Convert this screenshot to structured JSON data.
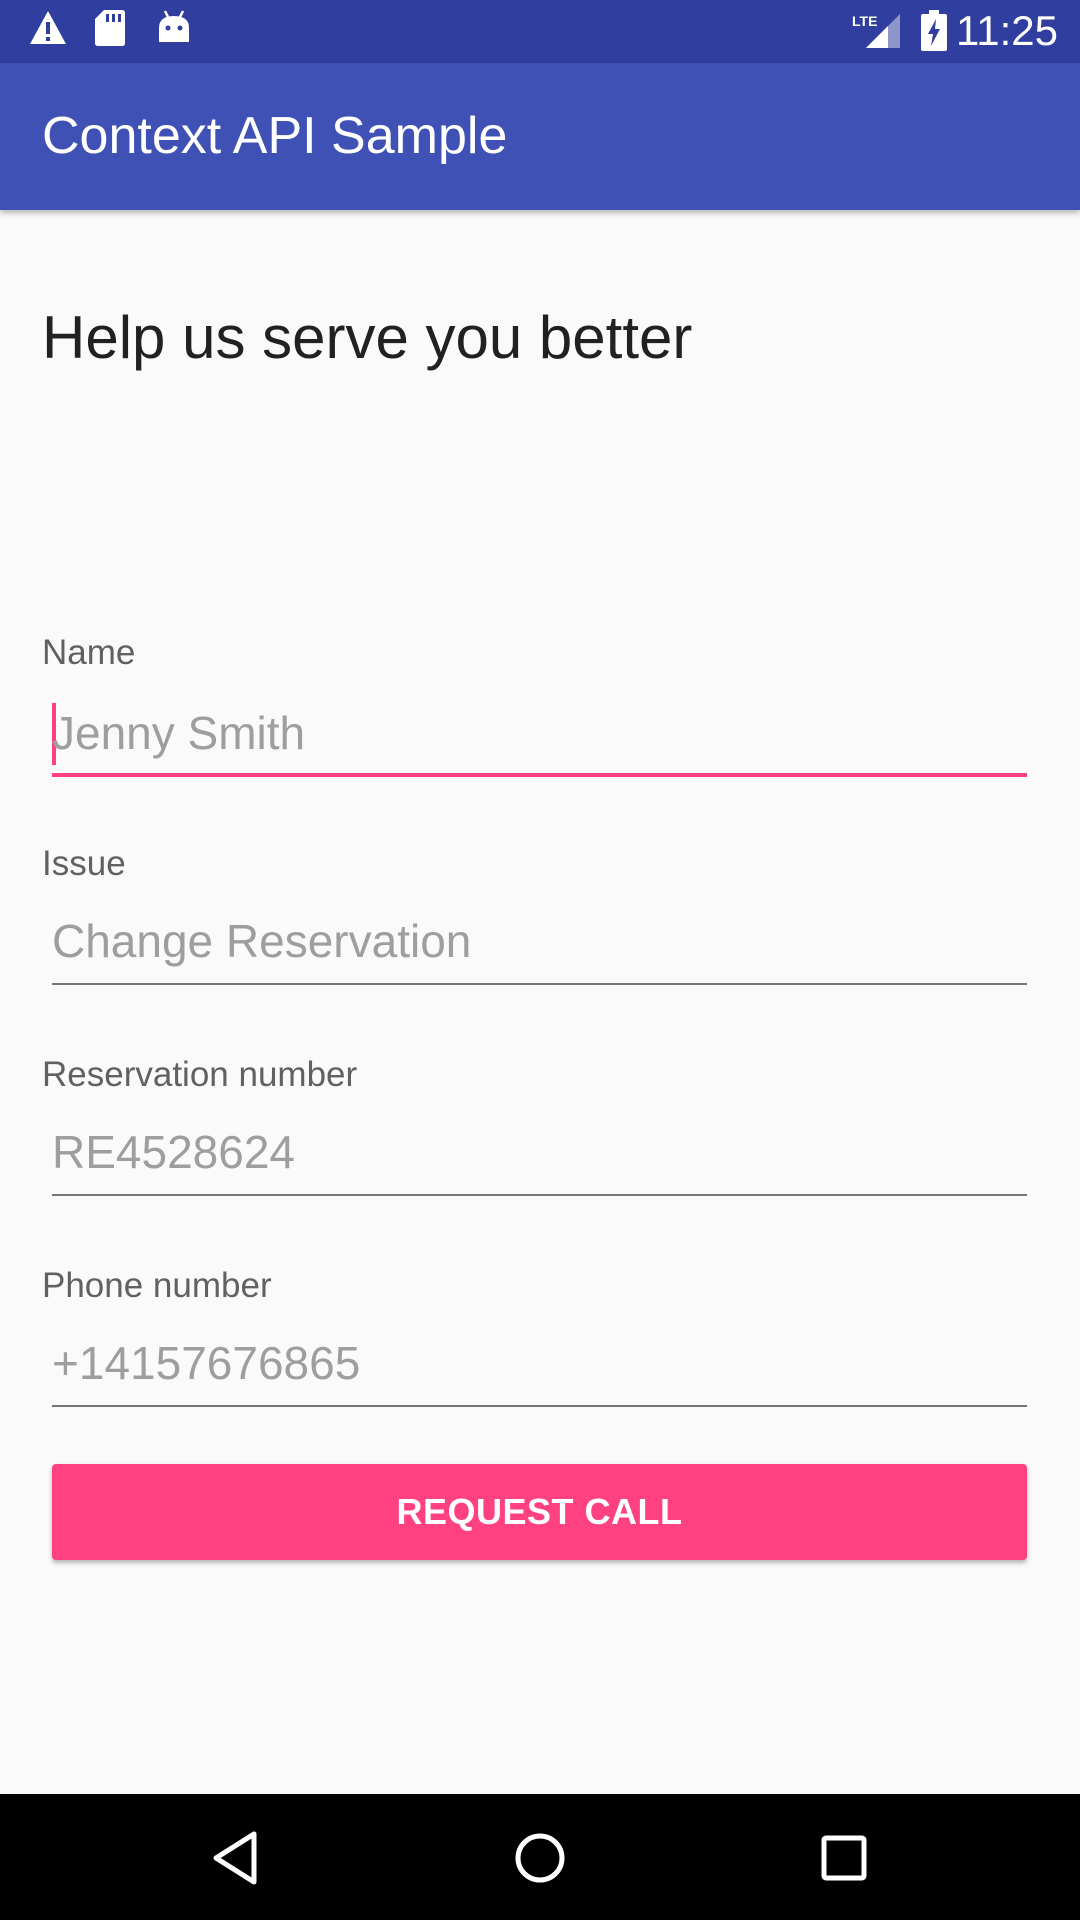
{
  "status_bar": {
    "time": "11:25",
    "network_label": "LTE",
    "icons": [
      "warning-icon",
      "sd-card-icon",
      "android-icon",
      "signal-icon",
      "battery-charging-icon"
    ],
    "background": "#303f9f"
  },
  "app_bar": {
    "title": "Context API Sample",
    "background": "#3f51b5"
  },
  "main": {
    "heading": "Help us serve you better",
    "fields": [
      {
        "label": "Name",
        "value": "Jenny Smith",
        "focused": true
      },
      {
        "label": "Issue",
        "value": "Change Reservation",
        "focused": false
      },
      {
        "label": "Reservation number",
        "value": "RE4528624",
        "focused": false
      },
      {
        "label": "Phone number",
        "value": "+14157676865",
        "focused": false
      }
    ],
    "button_label": "REQUEST CALL",
    "accent_color": "#ff4081"
  },
  "nav_bar": {
    "icons": [
      "back-icon",
      "home-icon",
      "recents-icon"
    ]
  }
}
